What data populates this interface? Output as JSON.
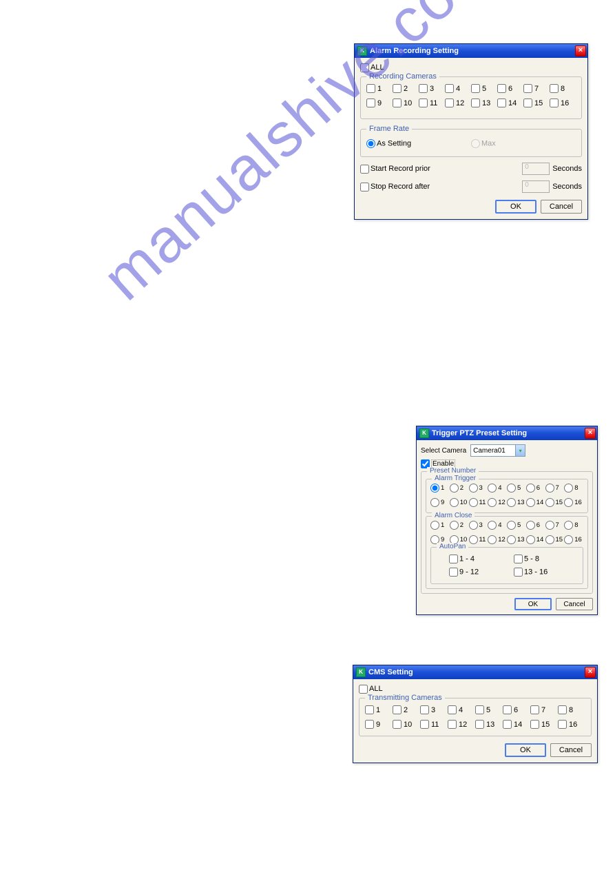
{
  "watermark": "manualshive.com",
  "dlg1": {
    "title": "Alarm Recording Setting",
    "all": "ALL",
    "group_cameras": "Recording Cameras",
    "cameras": [
      "1",
      "2",
      "3",
      "4",
      "5",
      "6",
      "7",
      "8",
      "9",
      "10",
      "11",
      "12",
      "13",
      "14",
      "15",
      "16"
    ],
    "group_framerate": "Frame Rate",
    "as_setting": "As Setting",
    "max": "Max",
    "start_prior": "Start Record prior",
    "stop_after": "Stop Record after",
    "seconds": "Seconds",
    "prior_val": "0",
    "after_val": "0",
    "ok": "OK",
    "cancel": "Cancel"
  },
  "dlg2": {
    "title": "Trigger PTZ Preset Setting",
    "select_camera": "Select Camera",
    "camera_value": "Camera01",
    "enable": "Enable",
    "preset_number": "Preset Number",
    "alarm_trigger": "Alarm Trigger",
    "alarm_close": "Alarm Close",
    "autopan": "AutoPan",
    "presets": [
      "1",
      "2",
      "3",
      "4",
      "5",
      "6",
      "7",
      "8",
      "9",
      "10",
      "11",
      "12",
      "13",
      "14",
      "15",
      "16"
    ],
    "autopan_ranges": [
      "1 - 4",
      "5 - 8",
      "9 - 12",
      "13 - 16"
    ],
    "ok": "OK",
    "cancel": "Cancel"
  },
  "dlg3": {
    "title": "CMS Setting",
    "all": "ALL",
    "group_cameras": "Transmitting Cameras",
    "cameras": [
      "1",
      "2",
      "3",
      "4",
      "5",
      "6",
      "7",
      "8",
      "9",
      "10",
      "11",
      "12",
      "13",
      "14",
      "15",
      "16"
    ],
    "ok": "OK",
    "cancel": "Cancel"
  }
}
